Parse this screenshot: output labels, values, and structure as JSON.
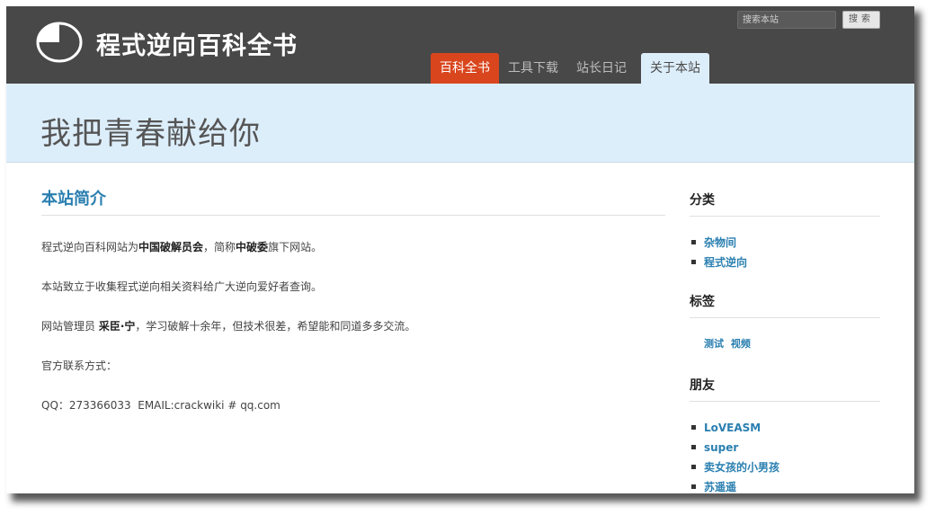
{
  "header": {
    "site_title": "程式逆向百科全书",
    "search_placeholder": "搜索本站",
    "search_button": "搜索",
    "nav": [
      "百科全书",
      "工具下载",
      "站长日记",
      "关于本站"
    ]
  },
  "banner": {
    "title": "我把青春献给你"
  },
  "main": {
    "section_title": "本站简介",
    "p1": {
      "before": "程式逆向百科网站为",
      "bold1": "中国破解员会",
      "middle": "，简称",
      "bold2": "中破委",
      "after": "旗下网站。"
    },
    "p2": "本站致立于收集程式逆向相关资料给广大逆向爱好者查询。",
    "p3": {
      "before": "网站管理员 ",
      "bold": "采臣·宁",
      "after": "，学习破解十余年，但技术很差，希望能和同道多多交流。"
    },
    "p4": "官方联系方式：",
    "p5": "QQ：273366033  EMAIL:crackwiki # qq.com"
  },
  "sidebar": {
    "categories_title": "分类",
    "categories": [
      "杂物间",
      "程式逆向"
    ],
    "tags_title": "标签",
    "tags": [
      "测试",
      "视频"
    ],
    "friends_title": "朋友",
    "friends": [
      "LoVEASM",
      "super",
      "卖女孩的小男孩",
      "苏遥遥"
    ]
  },
  "colors": {
    "header_bg": "#484848",
    "active_tab": "#d9461e",
    "banner_bg": "#ddeefb",
    "link": "#2a7fb0"
  }
}
